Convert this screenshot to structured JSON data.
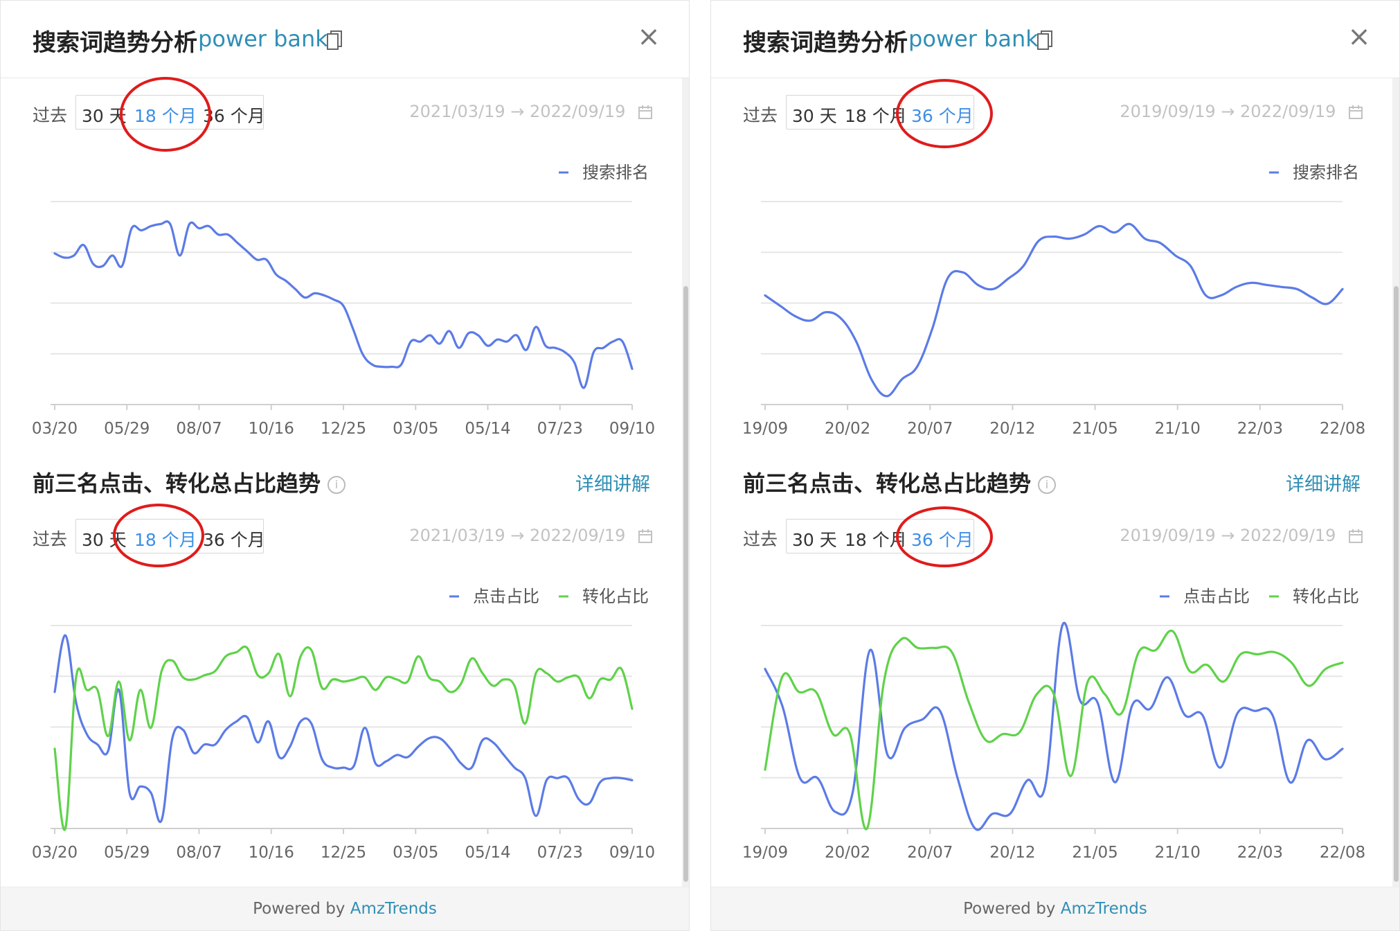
{
  "panels": [
    {
      "title": "搜索词趋势分析",
      "keyword": "power bank",
      "range_label": "过去",
      "options": [
        "30 天",
        "18 个月",
        "36 个月"
      ],
      "active_option": 1,
      "date_range": "2021/03/19 → 2022/09/19",
      "section_title": "前三名点击、转化总占比趋势",
      "detail_link": "详细讲解",
      "footer_prefix": "Powered by ",
      "footer_brand": "AmzTrends"
    },
    {
      "title": "搜索词趋势分析",
      "keyword": "power bank",
      "range_label": "过去",
      "options": [
        "30 天",
        "18 个月",
        "36 个月"
      ],
      "active_option": 2,
      "date_range": "2019/09/19 → 2022/09/19",
      "section_title": "前三名点击、转化总占比趋势",
      "detail_link": "详细讲解",
      "footer_prefix": "Powered by ",
      "footer_brand": "AmzTrends"
    }
  ],
  "colors": {
    "blue_series": "#5b7be6",
    "green_series": "#5fd24a",
    "accent_link": "#2f8fb5",
    "active_option": "#3d8fe6",
    "annotation": "#e01b1b"
  },
  "chart_data": [
    {
      "type": "line",
      "panel": "left",
      "x_ticks": [
        "03/20",
        "05/29",
        "08/07",
        "10/16",
        "12/25",
        "03/05",
        "05/14",
        "07/23",
        "09/10"
      ],
      "legend": "top-right",
      "grid": true,
      "yaxis_labels": false,
      "ylim": [
        0,
        100
      ],
      "series": [
        {
          "name": "搜索排名",
          "color": "#5b7be6",
          "values": [
            72,
            70,
            71,
            76,
            67,
            66,
            71,
            66,
            84,
            83,
            85,
            86,
            86,
            71,
            86,
            84,
            85,
            81,
            81,
            77,
            73,
            69,
            69,
            62,
            59,
            55,
            51,
            53,
            52,
            50,
            47,
            36,
            24,
            19,
            18,
            18,
            19,
            30,
            30,
            33,
            29,
            35,
            27,
            34,
            33,
            28,
            31,
            30,
            33,
            26,
            37,
            28,
            27,
            25,
            20,
            8,
            25,
            27,
            30,
            30,
            17
          ]
        }
      ]
    },
    {
      "type": "line",
      "panel": "left",
      "x_ticks": [
        "03/20",
        "05/29",
        "08/07",
        "10/16",
        "12/25",
        "03/05",
        "05/14",
        "07/23",
        "09/10"
      ],
      "legend": "top-right",
      "grid": true,
      "yaxis_labels": false,
      "ylim": [
        0,
        100
      ],
      "series": [
        {
          "name": "点击占比",
          "color": "#5b7be6",
          "values": [
            65,
            92,
            60,
            45,
            40,
            37,
            66,
            17,
            20,
            17,
            4,
            43,
            47,
            36,
            40,
            40,
            47,
            51,
            53,
            41,
            51,
            34,
            39,
            51,
            50,
            33,
            29,
            29,
            30,
            48,
            31,
            32,
            35,
            34,
            39,
            43,
            43,
            38,
            31,
            29,
            42,
            41,
            35,
            29,
            24,
            6,
            23,
            24,
            24,
            14,
            12,
            22,
            24,
            24,
            23
          ]
        },
        {
          "name": "转化占比",
          "color": "#5fd24a",
          "values": [
            38,
            0,
            72,
            66,
            66,
            44,
            70,
            42,
            66,
            48,
            75,
            80,
            72,
            71,
            73,
            75,
            82,
            84,
            86,
            73,
            74,
            83,
            63,
            82,
            85,
            67,
            71,
            70,
            71,
            72,
            66,
            72,
            71,
            70,
            82,
            72,
            70,
            65,
            69,
            81,
            74,
            68,
            71,
            68,
            50,
            74,
            74,
            70,
            72,
            72,
            62,
            71,
            71,
            76,
            57
          ]
        }
      ]
    },
    {
      "type": "line",
      "panel": "right",
      "x_ticks": [
        "19/09",
        "20/02",
        "20/07",
        "20/12",
        "21/05",
        "21/10",
        "22/03",
        "22/08"
      ],
      "legend": "top-right",
      "grid": true,
      "yaxis_labels": false,
      "ylim": [
        0,
        100
      ],
      "series": [
        {
          "name": "搜索排名",
          "color": "#5b7be6",
          "values": [
            52,
            47,
            42,
            40,
            44,
            41,
            30,
            12,
            4,
            12,
            18,
            36,
            60,
            63,
            57,
            55,
            60,
            66,
            78,
            80,
            79,
            81,
            85,
            82,
            86,
            79,
            77,
            71,
            66,
            52,
            52,
            56,
            58,
            57,
            56,
            55,
            51,
            48,
            55
          ]
        }
      ]
    },
    {
      "type": "line",
      "panel": "right",
      "x_ticks": [
        "19/09",
        "20/02",
        "20/07",
        "20/12",
        "21/05",
        "21/10",
        "22/03",
        "22/08"
      ],
      "legend": "top-right",
      "grid": true,
      "yaxis_labels": false,
      "ylim": [
        0,
        100
      ],
      "series": [
        {
          "name": "点击占比",
          "color": "#5b7be6",
          "values": [
            76,
            58,
            24,
            24,
            8,
            17,
            85,
            35,
            48,
            52,
            56,
            24,
            0,
            7,
            7,
            23,
            20,
            97,
            61,
            60,
            22,
            59,
            57,
            72,
            54,
            54,
            29,
            55,
            56,
            54,
            22,
            42,
            33,
            38
          ]
        },
        {
          "name": "转化占比",
          "color": "#5fd24a",
          "values": [
            28,
            72,
            65,
            65,
            45,
            45,
            0,
            70,
            90,
            86,
            86,
            84,
            60,
            42,
            45,
            46,
            64,
            64,
            25,
            70,
            64,
            55,
            84,
            85,
            94,
            75,
            78,
            70,
            83,
            83,
            84,
            79,
            68,
            76,
            79
          ]
        }
      ]
    }
  ]
}
